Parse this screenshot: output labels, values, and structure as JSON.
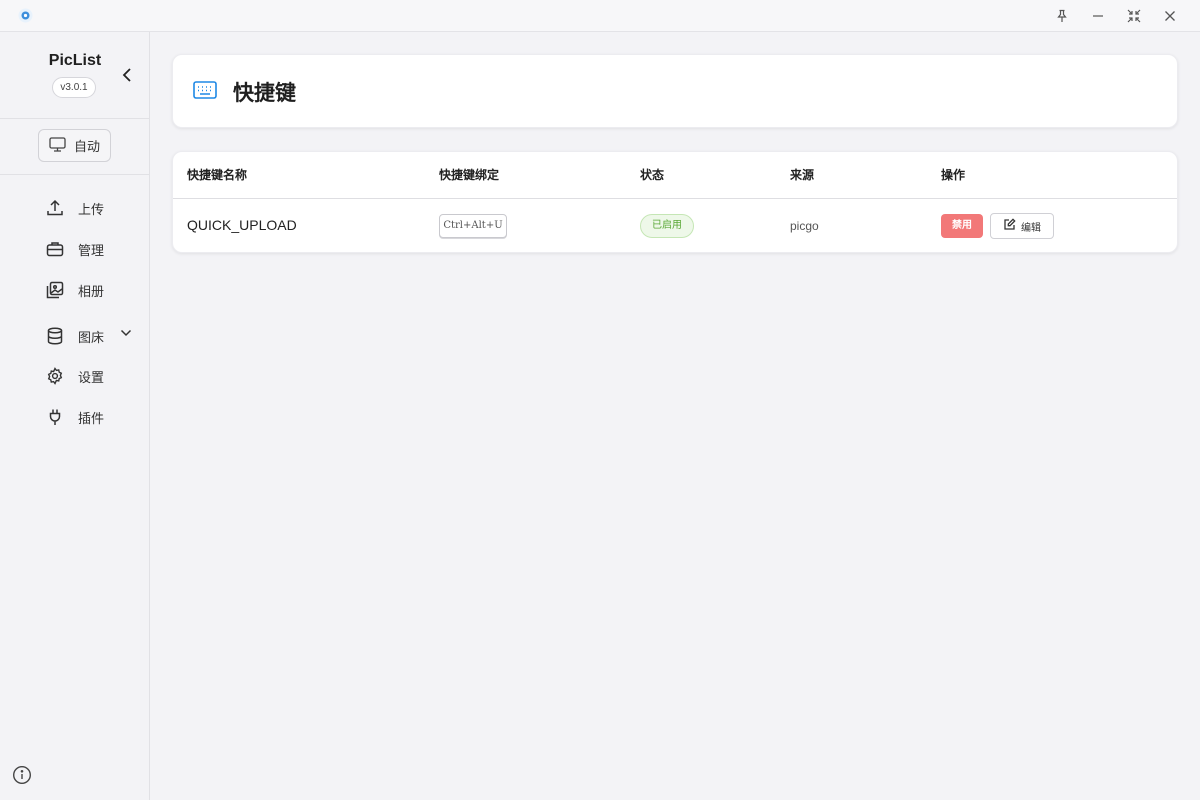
{
  "colors": {
    "accent": "#1e88e5",
    "danger": "#f27878",
    "success": "#5aa836",
    "background": "#f3f3f6"
  },
  "titlebar": {
    "icons": [
      "app-icon",
      "pin-icon",
      "minimize-icon",
      "restore-icon",
      "close-icon"
    ]
  },
  "sidebar": {
    "app_name": "PicList",
    "version": "v3.0.1",
    "theme_label": "自动",
    "items": [
      {
        "label": "上传",
        "icon": "upload-icon"
      },
      {
        "label": "管理",
        "icon": "briefcase-icon"
      },
      {
        "label": "相册",
        "icon": "gallery-icon"
      },
      {
        "label": "图床",
        "icon": "database-icon"
      },
      {
        "label": "设置",
        "icon": "gear-icon"
      },
      {
        "label": "插件",
        "icon": "plug-icon"
      }
    ]
  },
  "page": {
    "title": "快捷键",
    "icon": "keyboard-icon"
  },
  "table": {
    "headers": [
      "快捷键名称",
      "快捷键绑定",
      "状态",
      "来源",
      "操作"
    ],
    "rows": [
      {
        "name": "QUICK_UPLOAD",
        "binding": "Ctrl+Alt+U",
        "status": "已启用",
        "source": "picgo",
        "disable_label": "禁用",
        "edit_label": "编辑"
      }
    ]
  }
}
